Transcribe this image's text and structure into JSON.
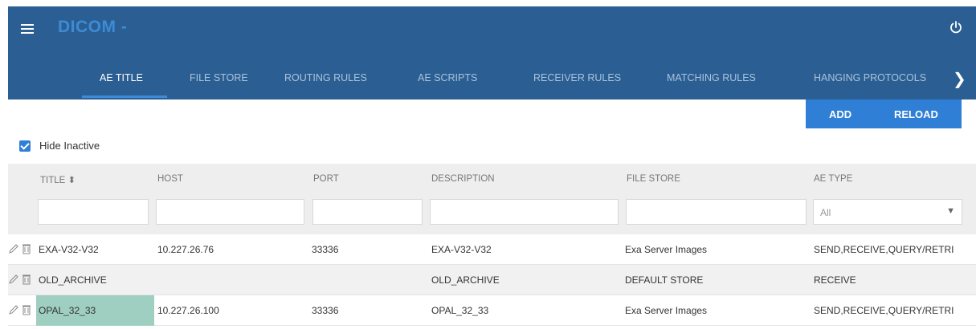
{
  "header": {
    "app_title": "DICOM -",
    "menu_icon": "hamburger-menu-icon",
    "power_icon": "power-icon",
    "background_color": "#2b5f93"
  },
  "tabs": [
    {
      "label": "AE TITLE",
      "active": true
    },
    {
      "label": "FILE STORE",
      "active": false
    },
    {
      "label": "ROUTING RULES",
      "active": false
    },
    {
      "label": "AE SCRIPTS",
      "active": false
    },
    {
      "label": "RECEIVER RULES",
      "active": false
    },
    {
      "label": "MATCHING RULES",
      "active": false
    },
    {
      "label": "HANGING PROTOCOLS",
      "active": false
    }
  ],
  "toolbar": {
    "add_label": "ADD",
    "reload_label": "RELOAD",
    "accent_color": "#2f7fd6"
  },
  "filters": {
    "hide_inactive_label": "Hide Inactive",
    "hide_inactive_checked": true
  },
  "table": {
    "columns": [
      "TITLE ⬍",
      "HOST",
      "PORT",
      "DESCRIPTION",
      "FILE STORE",
      "AE TYPE"
    ],
    "ae_type_filter_value": "All",
    "rows": [
      {
        "title": "EXA-V32-V32",
        "host": "10.227.26.76",
        "port": "33336",
        "description": "EXA-V32-V32",
        "file_store": "Exa Server Images",
        "ae_type": "SEND,RECEIVE,QUERY/RETRI"
      },
      {
        "title": "OLD_ARCHIVE",
        "host": "",
        "port": "",
        "description": "OLD_ARCHIVE",
        "file_store": "DEFAULT STORE",
        "ae_type": "RECEIVE"
      },
      {
        "title": "OPAL_32_33",
        "host": "10.227.26.100",
        "port": "33336",
        "description": "OPAL_32_33",
        "file_store": "Exa Server Images",
        "ae_type": "SEND,RECEIVE,QUERY/RETRI"
      }
    ]
  }
}
